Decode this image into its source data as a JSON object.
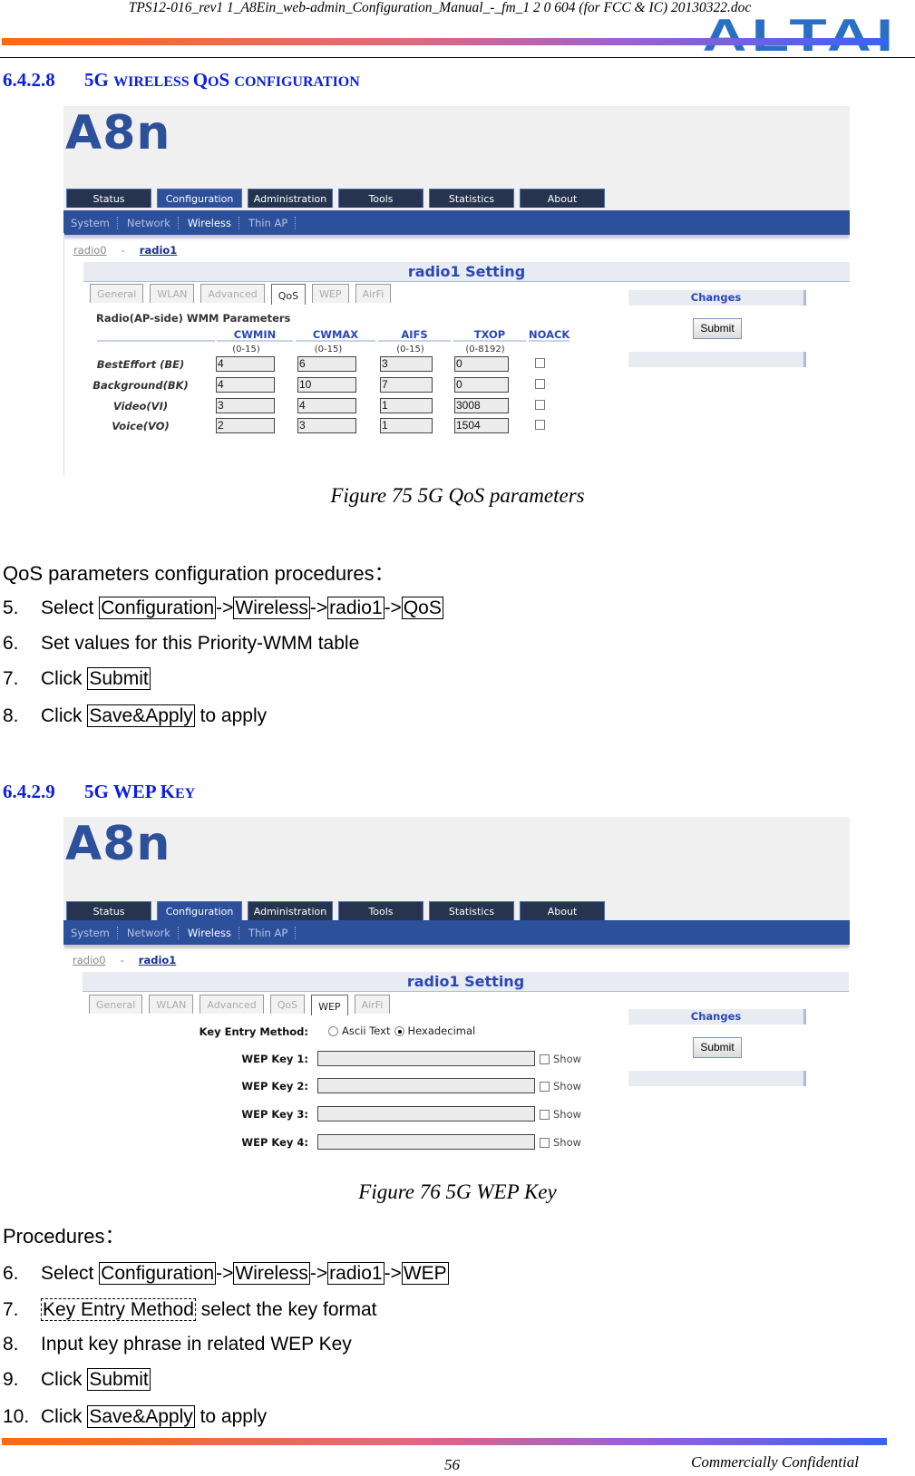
{
  "header": {
    "doc_title": "TPS12-016_rev1 1_A8Ein_web-admin_Configuration_Manual_-_fm_1 2 0 604 (for FCC & IC) 20130322.doc",
    "logo": "ALTAI"
  },
  "sections": [
    {
      "number": "6.4.2.8",
      "title_main": "5G ",
      "title_small_1": "WIRELESS ",
      "title_big": "Q",
      "title_small_2": "O",
      "title_big_2": "S ",
      "title_small_3": "CONFIGURATION"
    },
    {
      "number": "6.4.2.9",
      "title_main": "5G WEP K",
      "title_small_1": "EY"
    }
  ],
  "ui": {
    "brand": "A8n",
    "top_tabs": [
      "Status",
      "Configuration",
      "Administration",
      "Tools",
      "Statistics",
      "About"
    ],
    "active_top_tab": "Configuration",
    "sub_nav": [
      "System",
      "Network",
      "Wireless",
      "Thin AP"
    ],
    "active_sub_nav": "Wireless",
    "radio_links": {
      "radio0": "radio0",
      "separator": "-",
      "radio1": "radio1"
    },
    "setting_title": "radio1 Setting",
    "sub_tabs": [
      "General",
      "WLAN",
      "Advanced",
      "QoS",
      "WEP",
      "AirFi"
    ],
    "changes_label": "Changes",
    "submit_label": "Submit"
  },
  "qos": {
    "active_sub_tab": "QoS",
    "section_title": "Radio(AP-side) WMM Parameters",
    "columns": [
      {
        "name": "CWMIN",
        "range": "(0-15)"
      },
      {
        "name": "CWMAX",
        "range": "(0-15)"
      },
      {
        "name": "AIFS",
        "range": "(0-15)"
      },
      {
        "name": "TXOP",
        "range": "(0-8192)"
      },
      {
        "name": "NOACK",
        "range": ""
      }
    ],
    "rows": [
      {
        "label": "BestEffort (BE)",
        "cwmin": "4",
        "cwmax": "6",
        "aifs": "3",
        "txop": "0",
        "noack": false
      },
      {
        "label": "Background(BK)",
        "cwmin": "4",
        "cwmax": "10",
        "aifs": "7",
        "txop": "0",
        "noack": false
      },
      {
        "label": "Video(VI)",
        "cwmin": "3",
        "cwmax": "4",
        "aifs": "1",
        "txop": "3008",
        "noack": false
      },
      {
        "label": "Voice(VO)",
        "cwmin": "2",
        "cwmax": "3",
        "aifs": "1",
        "txop": "1504",
        "noack": false
      }
    ],
    "caption": "Figure 75 5G QoS parameters",
    "intro": "QoS parameters configuration procedures：",
    "steps": [
      {
        "n": "5.",
        "pre": "Select ",
        "boxes": [
          "Configuration",
          "Wireless",
          "radio1",
          "QoS"
        ],
        "sep": "->"
      },
      {
        "n": "6.",
        "text": "Set values for this Priority-WMM table"
      },
      {
        "n": "7.",
        "pre": "Click ",
        "box": "Submit",
        "post": ""
      },
      {
        "n": "8.",
        "pre": "Click ",
        "box": "Save&Apply",
        "post": " to apply"
      }
    ]
  },
  "wep": {
    "active_sub_tab": "WEP",
    "key_entry_label": "Key Entry Method:",
    "options": [
      {
        "label": "Ascii Text",
        "selected": false
      },
      {
        "label": "Hexadecimal",
        "selected": true
      }
    ],
    "keys": [
      {
        "label": "WEP Key 1:",
        "value": "",
        "show_label": "Show",
        "show": false
      },
      {
        "label": "WEP Key 2:",
        "value": "",
        "show_label": "Show",
        "show": false
      },
      {
        "label": "WEP Key 3:",
        "value": "",
        "show_label": "Show",
        "show": false
      },
      {
        "label": "WEP Key 4:",
        "value": "",
        "show_label": "Show",
        "show": false
      }
    ],
    "caption": "Figure 76 5G WEP Key",
    "intro": "Procedures：",
    "steps": [
      {
        "n": "6.",
        "pre": "Select ",
        "boxes": [
          "Configuration",
          "Wireless",
          "radio1",
          "WEP"
        ],
        "sep": "->"
      },
      {
        "n": "7.",
        "dbox": "Key Entry Method",
        "post": " select the key format"
      },
      {
        "n": "8.",
        "text": "Input key phrase in related WEP Key"
      },
      {
        "n": "9.",
        "pre": "Click ",
        "box": "Submit",
        "post": ""
      },
      {
        "n": "10.",
        "pre": "Click ",
        "box": "Save&Apply",
        "post": " to apply"
      }
    ]
  },
  "footer": {
    "page_number": "56",
    "confidential": "Commercially Confidential"
  }
}
